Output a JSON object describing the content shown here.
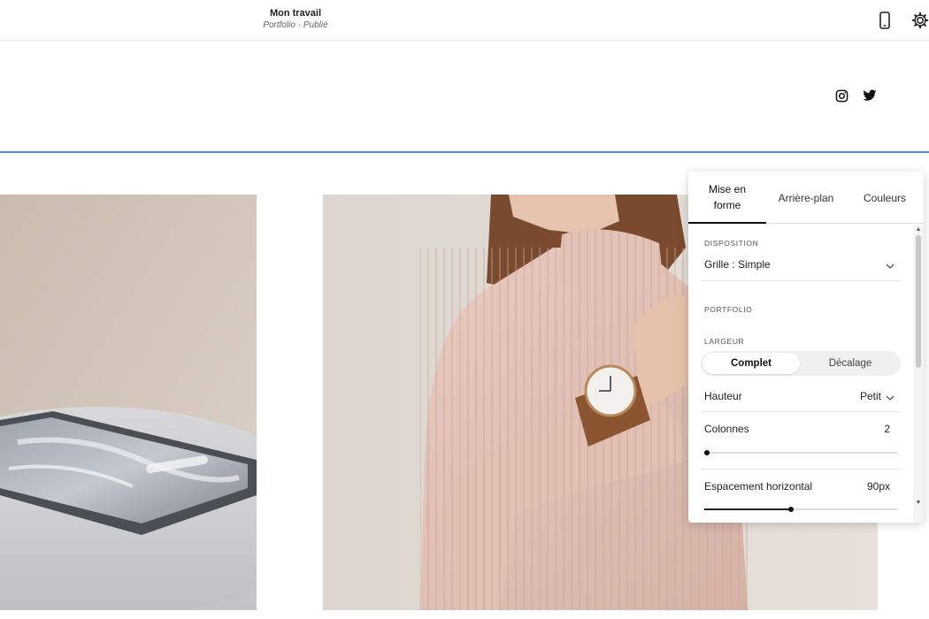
{
  "header": {
    "title": "Mon travail",
    "subtitle": "Portfolio · Publié",
    "icons": [
      "mobile-icon",
      "gear-icon"
    ]
  },
  "site": {
    "social_icons": [
      "instagram-icon",
      "twitter-icon"
    ]
  },
  "gallery": {
    "images": [
      "plate-photo",
      "woman-watch-photo"
    ]
  },
  "panel": {
    "tabs": [
      {
        "label": "Mise en forme",
        "active": true
      },
      {
        "label": "Arrière-plan",
        "active": false
      },
      {
        "label": "Couleurs",
        "active": false
      }
    ],
    "layout_label": "DISPOSITION",
    "layout_value": "Grille : Simple",
    "portfolio_label": "PORTFOLIO",
    "width_label": "LARGEUR",
    "width_options": [
      "Complet",
      "Décalage"
    ],
    "width_selected": "Complet",
    "height_label": "Hauteur",
    "height_value": "Petit",
    "columns_label": "Colonnes",
    "columns_value": "2",
    "columns_slider_fraction": 0.0,
    "spacing_label": "Espacement horizontal",
    "spacing_value": "90px",
    "spacing_slider_fraction": 0.45
  },
  "colors": {
    "accent_border": "#4a90c8",
    "panel_bg": "#ffffff"
  }
}
